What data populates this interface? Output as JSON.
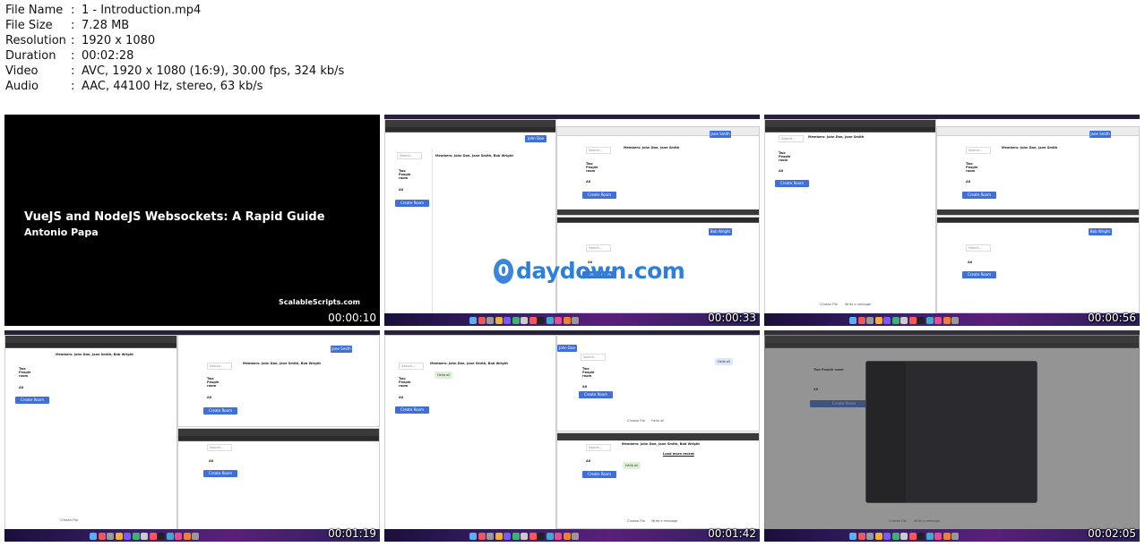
{
  "file_info": {
    "rows": [
      {
        "key": "File Name",
        "sep": ":",
        "value": "1 - Introduction.mp4"
      },
      {
        "key": "File Size",
        "sep": ":",
        "value": "7.28 MB"
      },
      {
        "key": "Resolution",
        "sep": ":",
        "value": "1920 x 1080"
      },
      {
        "key": "Duration",
        "sep": ":",
        "value": "00:02:28"
      },
      {
        "key": "Video",
        "sep": ":",
        "value": "AVC, 1920 x 1080 (16:9), 30.00 fps, 324 kb/s"
      },
      {
        "key": "Audio",
        "sep": ":",
        "value": "AAC, 44100 Hz, stereo, 63 kb/s"
      }
    ]
  },
  "thumbnails": [
    {
      "timestamp": "00:00:10"
    },
    {
      "timestamp": "00:00:33"
    },
    {
      "timestamp": "00:00:56"
    },
    {
      "timestamp": "00:01:19"
    },
    {
      "timestamp": "00:01:42"
    },
    {
      "timestamp": "00:02:05"
    }
  ],
  "title_card": {
    "title": "VueJS and NodeJS Websockets: A Rapid Guide",
    "author": "Antonio Papa",
    "brand": "ScalableScripts.com"
  },
  "app": {
    "search_placeholder": "Search...",
    "room_two_people": "Two People room",
    "room_all": "All",
    "create_room": "Create Room",
    "members_three": "Members: John Doe, Jane Smith, Bob Wright",
    "members_two": "Members: John Doe, Jane Smith",
    "user_john": "John Doe",
    "user_jane": "Jane Smith",
    "user_bob": "Bob Wright",
    "choose_file": "Choose File",
    "message_placeholder": "Write a message",
    "message_hello": "Hello all",
    "load_more": "Load more recent"
  },
  "watermark": {
    "logo": "0",
    "text": "daydown.com"
  },
  "colors": {
    "accent": "#3f6fd8",
    "watermark": "#2d7fd8",
    "dock": "#3b1f6b"
  }
}
